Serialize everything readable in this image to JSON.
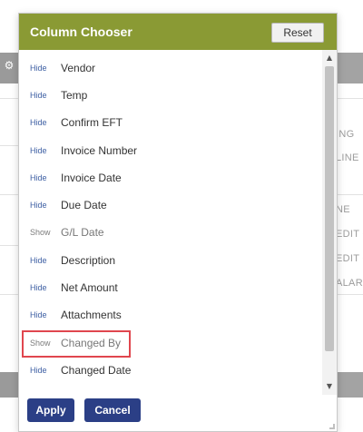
{
  "background": {
    "gear_icon": "gear-icon",
    "right_fragments": [
      "ING",
      "LINE",
      "NE",
      "EDIT C",
      "EDIT C",
      "ALARM"
    ]
  },
  "popup": {
    "title": "Column Chooser",
    "reset_label": "Reset",
    "columns": [
      {
        "toggle": "Hide",
        "label": "Vendor",
        "visible": true
      },
      {
        "toggle": "Hide",
        "label": "Temp",
        "visible": true
      },
      {
        "toggle": "Hide",
        "label": "Confirm EFT",
        "visible": true
      },
      {
        "toggle": "Hide",
        "label": "Invoice Number",
        "visible": true
      },
      {
        "toggle": "Hide",
        "label": "Invoice Date",
        "visible": true
      },
      {
        "toggle": "Hide",
        "label": "Due Date",
        "visible": true
      },
      {
        "toggle": "Show",
        "label": "G/L Date",
        "visible": false
      },
      {
        "toggle": "Hide",
        "label": "Description",
        "visible": true
      },
      {
        "toggle": "Hide",
        "label": "Net Amount",
        "visible": true
      },
      {
        "toggle": "Hide",
        "label": "Attachments",
        "visible": true
      },
      {
        "toggle": "Show",
        "label": "Changed By",
        "visible": false
      },
      {
        "toggle": "Hide",
        "label": "Changed Date",
        "visible": true
      }
    ],
    "apply_label": "Apply",
    "cancel_label": "Cancel",
    "scroll_up_icon": "scroll-up-icon",
    "scroll_down_icon": "scroll-down-icon"
  },
  "colors": {
    "header": "#8a9a34",
    "primary_button": "#2b3f86",
    "hide_link": "#3d5fa3",
    "highlight": "#e0464e"
  }
}
